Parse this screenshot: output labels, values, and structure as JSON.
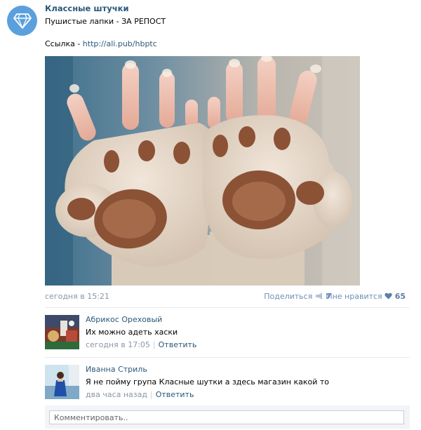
{
  "post": {
    "group_name": "Классные штучки",
    "text_line1": "Пушистые лапки - ЗА РЕПОСТ",
    "link_prefix": "Ссылка - ",
    "link_url": "http://ali.pub/hbptc",
    "date": "сегодня в 15:21",
    "share_label": "Поделиться",
    "share_count": "7",
    "like_label": "Мне нравится",
    "like_count": "65"
  },
  "comments": [
    {
      "author": "Абрикос Ореховый",
      "text": "Их можно адеть хаски",
      "time": "сегодня в 17:05",
      "reply_label": "Ответить"
    },
    {
      "author": "Иванна Стриль",
      "text": "Я не пойму група Класные шутки а здесь магазин какой то",
      "time": "два часа назад",
      "reply_label": "Ответить"
    }
  ],
  "reply": {
    "placeholder": "Комментировать.."
  },
  "colors": {
    "link": "#2b587a",
    "meta": "#8b96a3",
    "avatar_bg": "#5aa0dc"
  }
}
